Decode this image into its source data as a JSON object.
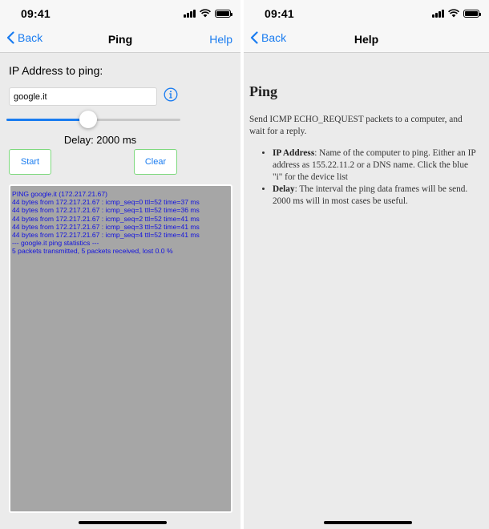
{
  "left": {
    "status": {
      "time": "09:41"
    },
    "nav": {
      "back": "Back",
      "title": "Ping",
      "right": "Help"
    },
    "ip_label": "IP Address to ping:",
    "ip_value": "google.it",
    "slider": {
      "value_fraction": 0.47
    },
    "delay_text": "Delay: 2000 ms",
    "start_label": "Start",
    "clear_label": "Clear",
    "output_lines": [
      "PING google.it (172.217.21.67)",
      "44 bytes from 172.217.21.67 : icmp_seq=0 ttl=52 time=37 ms",
      "44 bytes from 172.217.21.67 : icmp_seq=1 ttl=52 time=36 ms",
      "44 bytes from 172.217.21.67 : icmp_seq=2 ttl=52 time=41 ms",
      "44 bytes from 172.217.21.67 : icmp_seq=3 ttl=52 time=41 ms",
      "44 bytes from 172.217.21.67 : icmp_seq=4 ttl=52 time=41 ms",
      "--- google.it ping statistics ---",
      "5 packets transmitted, 5 packets received, lost 0.0 %"
    ]
  },
  "right": {
    "status": {
      "time": "09:41"
    },
    "nav": {
      "back": "Back",
      "title": "Help"
    },
    "help": {
      "heading": "Ping",
      "intro": "Send ICMP ECHO_REQUEST packets to a computer, and wait for a reply.",
      "items": [
        {
          "term": "IP Address",
          "text": ": Name of the computer to ping. Either an IP address as 155.22.11.2 or a DNS name. Click the blue \"i\" for the device list"
        },
        {
          "term": "Delay",
          "text": ": The interval the ping data frames will be send. 2000 ms will in most cases be useful."
        }
      ]
    }
  },
  "colors": {
    "accent": "#1a7cf0",
    "output_bg": "#a6a6a6",
    "output_text": "#1212e0",
    "button_border": "#7ed97e"
  },
  "icons": {
    "back": "chevron-left-icon",
    "info": "info-circle-icon",
    "wifi": "wifi-icon",
    "signal": "cellular-signal-icon",
    "battery": "battery-icon"
  }
}
